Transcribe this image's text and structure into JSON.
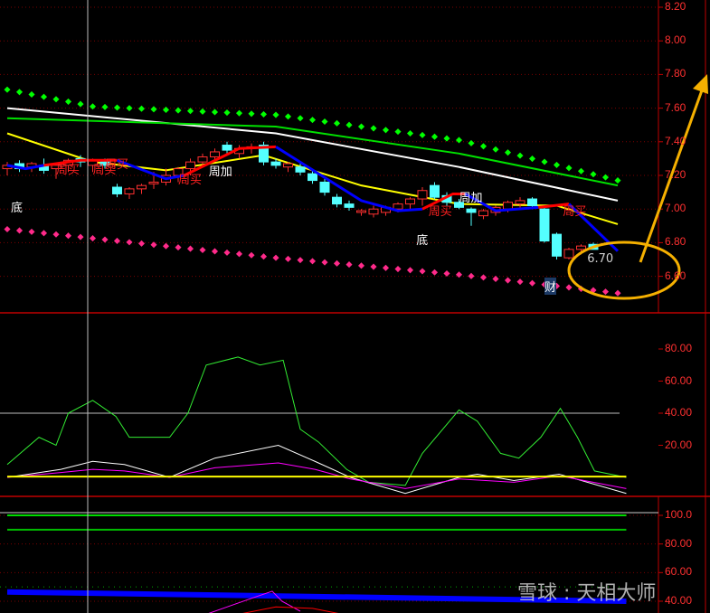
{
  "chart_data": [
    {
      "type": "candlestick",
      "title": "Price",
      "ylim": [
        6.45,
        8.25
      ],
      "yticks": [
        "8.20",
        "8.00",
        "7.80",
        "7.60",
        "7.40",
        "7.20",
        "7.00",
        "6.80",
        "6.60"
      ],
      "candles": [
        [
          7.24,
          7.28,
          7.2,
          7.26
        ],
        [
          7.27,
          7.29,
          7.22,
          7.24
        ],
        [
          7.25,
          7.28,
          7.22,
          7.27
        ],
        [
          7.26,
          7.3,
          7.21,
          7.23
        ],
        [
          7.24,
          7.27,
          7.18,
          7.26
        ],
        [
          7.26,
          7.3,
          7.22,
          7.29
        ],
        [
          7.3,
          7.32,
          7.25,
          7.28
        ],
        [
          7.26,
          7.3,
          7.22,
          7.29
        ],
        [
          7.28,
          7.3,
          7.24,
          7.26
        ],
        [
          7.13,
          7.15,
          7.07,
          7.09
        ],
        [
          7.09,
          7.13,
          7.06,
          7.12
        ],
        [
          7.12,
          7.15,
          7.09,
          7.14
        ],
        [
          7.15,
          7.22,
          7.12,
          7.16
        ],
        [
          7.16,
          7.24,
          7.14,
          7.2
        ],
        [
          7.2,
          7.25,
          7.16,
          7.24
        ],
        [
          7.24,
          7.3,
          7.2,
          7.28
        ],
        [
          7.28,
          7.33,
          7.25,
          7.31
        ],
        [
          7.31,
          7.36,
          7.28,
          7.34
        ],
        [
          7.38,
          7.4,
          7.33,
          7.35
        ],
        [
          7.33,
          7.38,
          7.3,
          7.36
        ],
        [
          7.36,
          7.39,
          7.33,
          7.37
        ],
        [
          7.38,
          7.4,
          7.26,
          7.28
        ],
        [
          7.28,
          7.3,
          7.24,
          7.26
        ],
        [
          7.25,
          7.28,
          7.22,
          7.27
        ],
        [
          7.25,
          7.27,
          7.2,
          7.22
        ],
        [
          7.21,
          7.23,
          7.15,
          7.17
        ],
        [
          7.16,
          7.18,
          7.08,
          7.1
        ],
        [
          7.07,
          7.09,
          7.01,
          7.03
        ],
        [
          7.03,
          7.05,
          6.99,
          7.01
        ],
        [
          6.98,
          7.0,
          6.96,
          6.99
        ],
        [
          6.97,
          7.02,
          6.95,
          7.0
        ],
        [
          6.98,
          7.02,
          6.96,
          7.01
        ],
        [
          7.0,
          7.04,
          6.98,
          7.03
        ],
        [
          7.03,
          7.07,
          7.0,
          7.06
        ],
        [
          7.06,
          7.13,
          7.02,
          7.11
        ],
        [
          7.14,
          7.16,
          7.06,
          7.07
        ],
        [
          7.08,
          7.1,
          7.02,
          7.04
        ],
        [
          7.04,
          7.06,
          7.0,
          7.01
        ],
        [
          7.0,
          7.01,
          6.9,
          6.98
        ],
        [
          6.96,
          7.0,
          6.94,
          6.99
        ],
        [
          6.98,
          7.02,
          6.96,
          7.01
        ],
        [
          7.0,
          7.05,
          6.98,
          7.04
        ],
        [
          7.03,
          7.07,
          7.0,
          7.05
        ],
        [
          7.06,
          7.07,
          7.0,
          7.02
        ],
        [
          7.0,
          7.01,
          6.8,
          6.81
        ],
        [
          6.85,
          6.86,
          6.7,
          6.72
        ],
        [
          6.71,
          6.77,
          6.7,
          6.76
        ],
        [
          6.76,
          6.79,
          6.73,
          6.78
        ],
        [
          6.79,
          6.8,
          6.76,
          6.76
        ]
      ],
      "lines": [
        {
          "name": "MA-white",
          "color": "#ffffff",
          "pts": [
            [
              0,
              7.6
            ],
            [
              22,
              7.45
            ],
            [
              37,
              7.25
            ],
            [
              50,
              7.05
            ]
          ]
        },
        {
          "name": "MA-green",
          "color": "#00e000",
          "pts": [
            [
              0,
              7.54
            ],
            [
              22,
              7.49
            ],
            [
              37,
              7.33
            ],
            [
              50,
              7.14
            ]
          ]
        },
        {
          "name": "MA-yellow",
          "color": "#ffff00",
          "pts": [
            [
              0,
              7.45
            ],
            [
              7,
              7.28
            ],
            [
              13,
              7.23
            ],
            [
              21,
              7.32
            ],
            [
              29,
              7.14
            ],
            [
              37,
              7.03
            ],
            [
              45,
              7.02
            ],
            [
              50,
              6.91
            ]
          ]
        }
      ],
      "trend": [
        {
          "color": "#0000ff",
          "pts": [
            [
              0,
              7.26
            ],
            [
              1.5,
              7.24
            ],
            [
              3,
              7.26
            ]
          ]
        },
        {
          "color": "#ff0000",
          "pts": [
            [
              3,
              7.26
            ],
            [
              6,
              7.29
            ],
            [
              9,
              7.29
            ]
          ]
        },
        {
          "color": "#0000ff",
          "pts": [
            [
              9,
              7.29
            ],
            [
              13,
              7.18
            ],
            [
              14.5,
              7.2
            ]
          ]
        },
        {
          "color": "#ff0000",
          "pts": [
            [
              14.5,
              7.2
            ],
            [
              19,
              7.36
            ],
            [
              22,
              7.37
            ]
          ]
        },
        {
          "color": "#0000ff",
          "pts": [
            [
              22,
              7.37
            ],
            [
              29,
              7.05
            ],
            [
              32,
              6.99
            ],
            [
              34,
              7.0
            ]
          ]
        },
        {
          "color": "#ff0000",
          "pts": [
            [
              34,
              7.0
            ],
            [
              36.5,
              7.09
            ],
            [
              37.5,
              7.09
            ]
          ]
        },
        {
          "color": "#0000ff",
          "pts": [
            [
              37.5,
              7.09
            ],
            [
              40,
              6.99
            ],
            [
              43.5,
              7.01
            ]
          ]
        },
        {
          "color": "#ff0000",
          "pts": [
            [
              43.5,
              7.01
            ],
            [
              46,
              7.03
            ]
          ]
        },
        {
          "color": "#0000ff",
          "pts": [
            [
              46,
              7.03
            ],
            [
              50,
              6.75
            ]
          ]
        }
      ],
      "dots_upper": {
        "color": "#00ff00",
        "pts": [
          [
            0,
            7.71
          ],
          [
            7,
            7.61
          ],
          [
            22,
            7.56
          ],
          [
            37,
            7.41
          ],
          [
            50,
            7.17
          ]
        ]
      },
      "dots_lower": {
        "color": "#ff2a8a",
        "pts": [
          [
            0,
            6.88
          ],
          [
            22,
            6.71
          ],
          [
            37,
            6.61
          ],
          [
            50,
            6.5
          ]
        ]
      },
      "annotations": [
        {
          "text": "周买",
          "i": 4,
          "p": 7.25,
          "color": "#ff2020"
        },
        {
          "text": "周买",
          "i": 7,
          "p": 7.25,
          "color": "#ff2020"
        },
        {
          "text": "周买",
          "i": 8,
          "p": 7.28,
          "color": "#ff2020"
        },
        {
          "text": "周买",
          "i": 14,
          "p": 7.19,
          "color": "#ff2020"
        },
        {
          "text": "周加",
          "i": 16.5,
          "p": 7.24,
          "color": "#ffffff"
        },
        {
          "text": "周买",
          "i": 34.5,
          "p": 7.0,
          "color": "#ff2020"
        },
        {
          "text": "周加",
          "i": 37,
          "p": 7.08,
          "color": "#ffffff"
        },
        {
          "text": "周买",
          "i": 45.5,
          "p": 7.0,
          "color": "#ff2020"
        },
        {
          "text": "底",
          "i": 0.3,
          "p": 7.02,
          "color": "#ffffff"
        },
        {
          "text": "底",
          "i": 33.5,
          "p": 6.83,
          "color": "#ffffff"
        },
        {
          "text": "6.70",
          "i": 47.5,
          "p": 6.7,
          "color": "#d0d0d0"
        },
        {
          "text": "财",
          "i": 44,
          "p": 6.55,
          "color": "#ffffff"
        }
      ]
    },
    {
      "type": "line",
      "title": "Oscillator",
      "ylim": [
        -12,
        95
      ],
      "yticks": [
        "80.00",
        "60.00",
        "40.00",
        "20.00"
      ],
      "ref": 40,
      "series": [
        {
          "name": "green",
          "color": "#33ee33",
          "pts": [
            [
              0,
              8
            ],
            [
              2.6,
              25
            ],
            [
              4,
              20
            ],
            [
              5,
              40
            ],
            [
              7,
              48
            ],
            [
              8.9,
              38
            ],
            [
              10,
              25
            ],
            [
              13.3,
              25
            ],
            [
              14.8,
              40
            ],
            [
              16.3,
              70
            ],
            [
              18.9,
              75
            ],
            [
              20.7,
              70
            ],
            [
              22.6,
              73
            ],
            [
              24,
              30
            ],
            [
              25.5,
              22
            ],
            [
              27.8,
              5
            ],
            [
              29.6,
              -3
            ],
            [
              32.6,
              -5
            ],
            [
              34,
              15
            ],
            [
              37,
              42
            ],
            [
              38.5,
              35
            ],
            [
              40.4,
              15
            ],
            [
              41.9,
              12
            ],
            [
              43.7,
              25
            ],
            [
              45.3,
              43
            ],
            [
              46.7,
              25
            ],
            [
              48.1,
              4
            ],
            [
              50.7,
              0
            ]
          ]
        },
        {
          "name": "white",
          "color": "#ffffff",
          "pts": [
            [
              0,
              0
            ],
            [
              4.4,
              5
            ],
            [
              7,
              10
            ],
            [
              9.6,
              8
            ],
            [
              13.3,
              0
            ],
            [
              17,
              12
            ],
            [
              22.2,
              20
            ],
            [
              25.2,
              10
            ],
            [
              28.1,
              0
            ],
            [
              32.6,
              -10
            ],
            [
              37,
              0
            ],
            [
              38.5,
              2
            ],
            [
              41.5,
              -2
            ],
            [
              45.2,
              2
            ],
            [
              50.7,
              -10
            ]
          ]
        },
        {
          "name": "magenta",
          "color": "#ff00ff",
          "pts": [
            [
              0,
              0
            ],
            [
              4.4,
              3
            ],
            [
              7,
              5
            ],
            [
              9.6,
              4
            ],
            [
              13.3,
              0
            ],
            [
              17,
              6
            ],
            [
              22.2,
              9
            ],
            [
              25.2,
              5
            ],
            [
              28.1,
              -1
            ],
            [
              32.6,
              -7
            ],
            [
              37,
              -1
            ],
            [
              41.5,
              -3
            ],
            [
              45.2,
              1
            ],
            [
              50.7,
              -7
            ]
          ]
        },
        {
          "name": "yellow",
          "color": "#ffff00",
          "pts": [
            [
              0,
              0.5
            ],
            [
              50.7,
              0.5
            ]
          ]
        }
      ]
    },
    {
      "type": "line",
      "title": "Indicator",
      "ylim": [
        30,
        105
      ],
      "yticks": [
        "100.0",
        "80.00",
        "60.00",
        "40.00"
      ],
      "series": [
        {
          "name": "green-100",
          "color": "#00dd00",
          "pts": [
            [
              0,
              100
            ],
            [
              50.7,
              100
            ]
          ]
        },
        {
          "name": "green-90",
          "color": "#00bb00",
          "pts": [
            [
              0,
              90
            ],
            [
              50.7,
              90
            ]
          ]
        },
        {
          "name": "blue-band",
          "color": "#0000ff",
          "pts": [
            [
              0,
              46.5
            ],
            [
              50.7,
              40
            ]
          ]
        },
        {
          "name": "magenta",
          "color": "#ff00ff",
          "pts": [
            [
              16,
              30
            ],
            [
              18,
              36
            ],
            [
              20,
              42
            ],
            [
              21.7,
              47
            ],
            [
              22.5,
              40
            ],
            [
              24,
              33
            ]
          ]
        },
        {
          "name": "red",
          "color": "#ff0000",
          "pts": [
            [
              19,
              31
            ],
            [
              22,
              36
            ],
            [
              25,
              35
            ],
            [
              28,
              30
            ]
          ]
        }
      ]
    }
  ],
  "watermark": "雪球 : 天相大师"
}
